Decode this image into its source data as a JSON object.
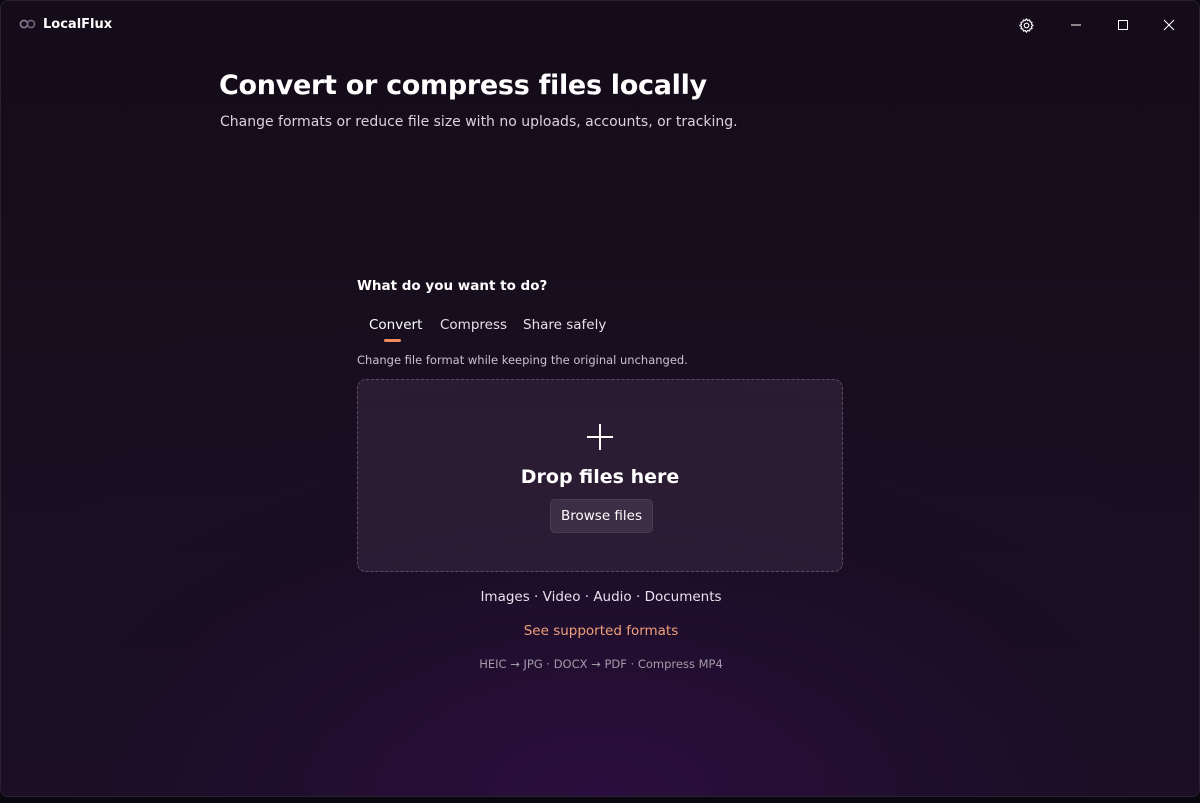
{
  "app": {
    "title": "LocalFlux"
  },
  "window_controls": {
    "settings_icon": "gear-icon",
    "minimize_icon": "minimize-icon",
    "maximize_icon": "maximize-icon",
    "close_icon": "close-icon"
  },
  "hero": {
    "title": "Convert or compress files locally",
    "subtitle": "Change formats or reduce file size with no uploads, accounts, or tracking."
  },
  "action": {
    "question": "What do you want to do?",
    "tabs": [
      {
        "label": "Convert",
        "active": true
      },
      {
        "label": "Compress",
        "active": false
      },
      {
        "label": "Share safely",
        "active": false
      }
    ],
    "description": "Change file format while keeping the original unchanged."
  },
  "dropzone": {
    "icon": "plus-icon",
    "title": "Drop files here",
    "browse_label": "Browse files"
  },
  "footer": {
    "types": "Images · Video · Audio · Documents",
    "formats_link": "See supported formats",
    "examples": "HEIC → JPG · DOCX → PDF · Compress MP4"
  },
  "colors": {
    "accent": "#f08a5d",
    "link": "#f0a07a",
    "background": "#150c1b"
  }
}
